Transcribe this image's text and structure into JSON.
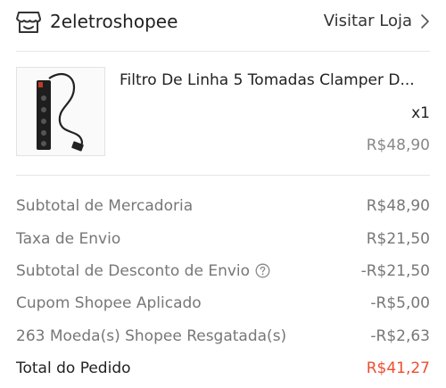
{
  "shop": {
    "name": "2eletroshopee",
    "visit_label": "Visitar Loja"
  },
  "product": {
    "name": "Filtro De Linha 5 Tomadas Clamper D...",
    "quantity": "x1",
    "price": "R$48,90"
  },
  "summary": {
    "rows": [
      {
        "label": "Subtotal de Mercadoria",
        "value": "R$48,90"
      },
      {
        "label": "Taxa de Envio",
        "value": "R$21,50"
      },
      {
        "label": "Subtotal de Desconto de Envio",
        "value": "-R$21,50"
      },
      {
        "label": "Cupom Shopee Aplicado",
        "value": "-R$5,00"
      },
      {
        "label": "263 Moeda(s) Shopee Resgatada(s)",
        "value": "-R$2,63"
      }
    ],
    "total": {
      "label": "Total do Pedido",
      "value": "R$41,27"
    }
  },
  "colors": {
    "accent": "#ee4d2d",
    "muted_text": "#777777",
    "divider": "#e6e6e6"
  },
  "icons": {
    "shop": "store-icon",
    "chevron": "chevron-right-icon",
    "help": "help-circle-icon"
  }
}
